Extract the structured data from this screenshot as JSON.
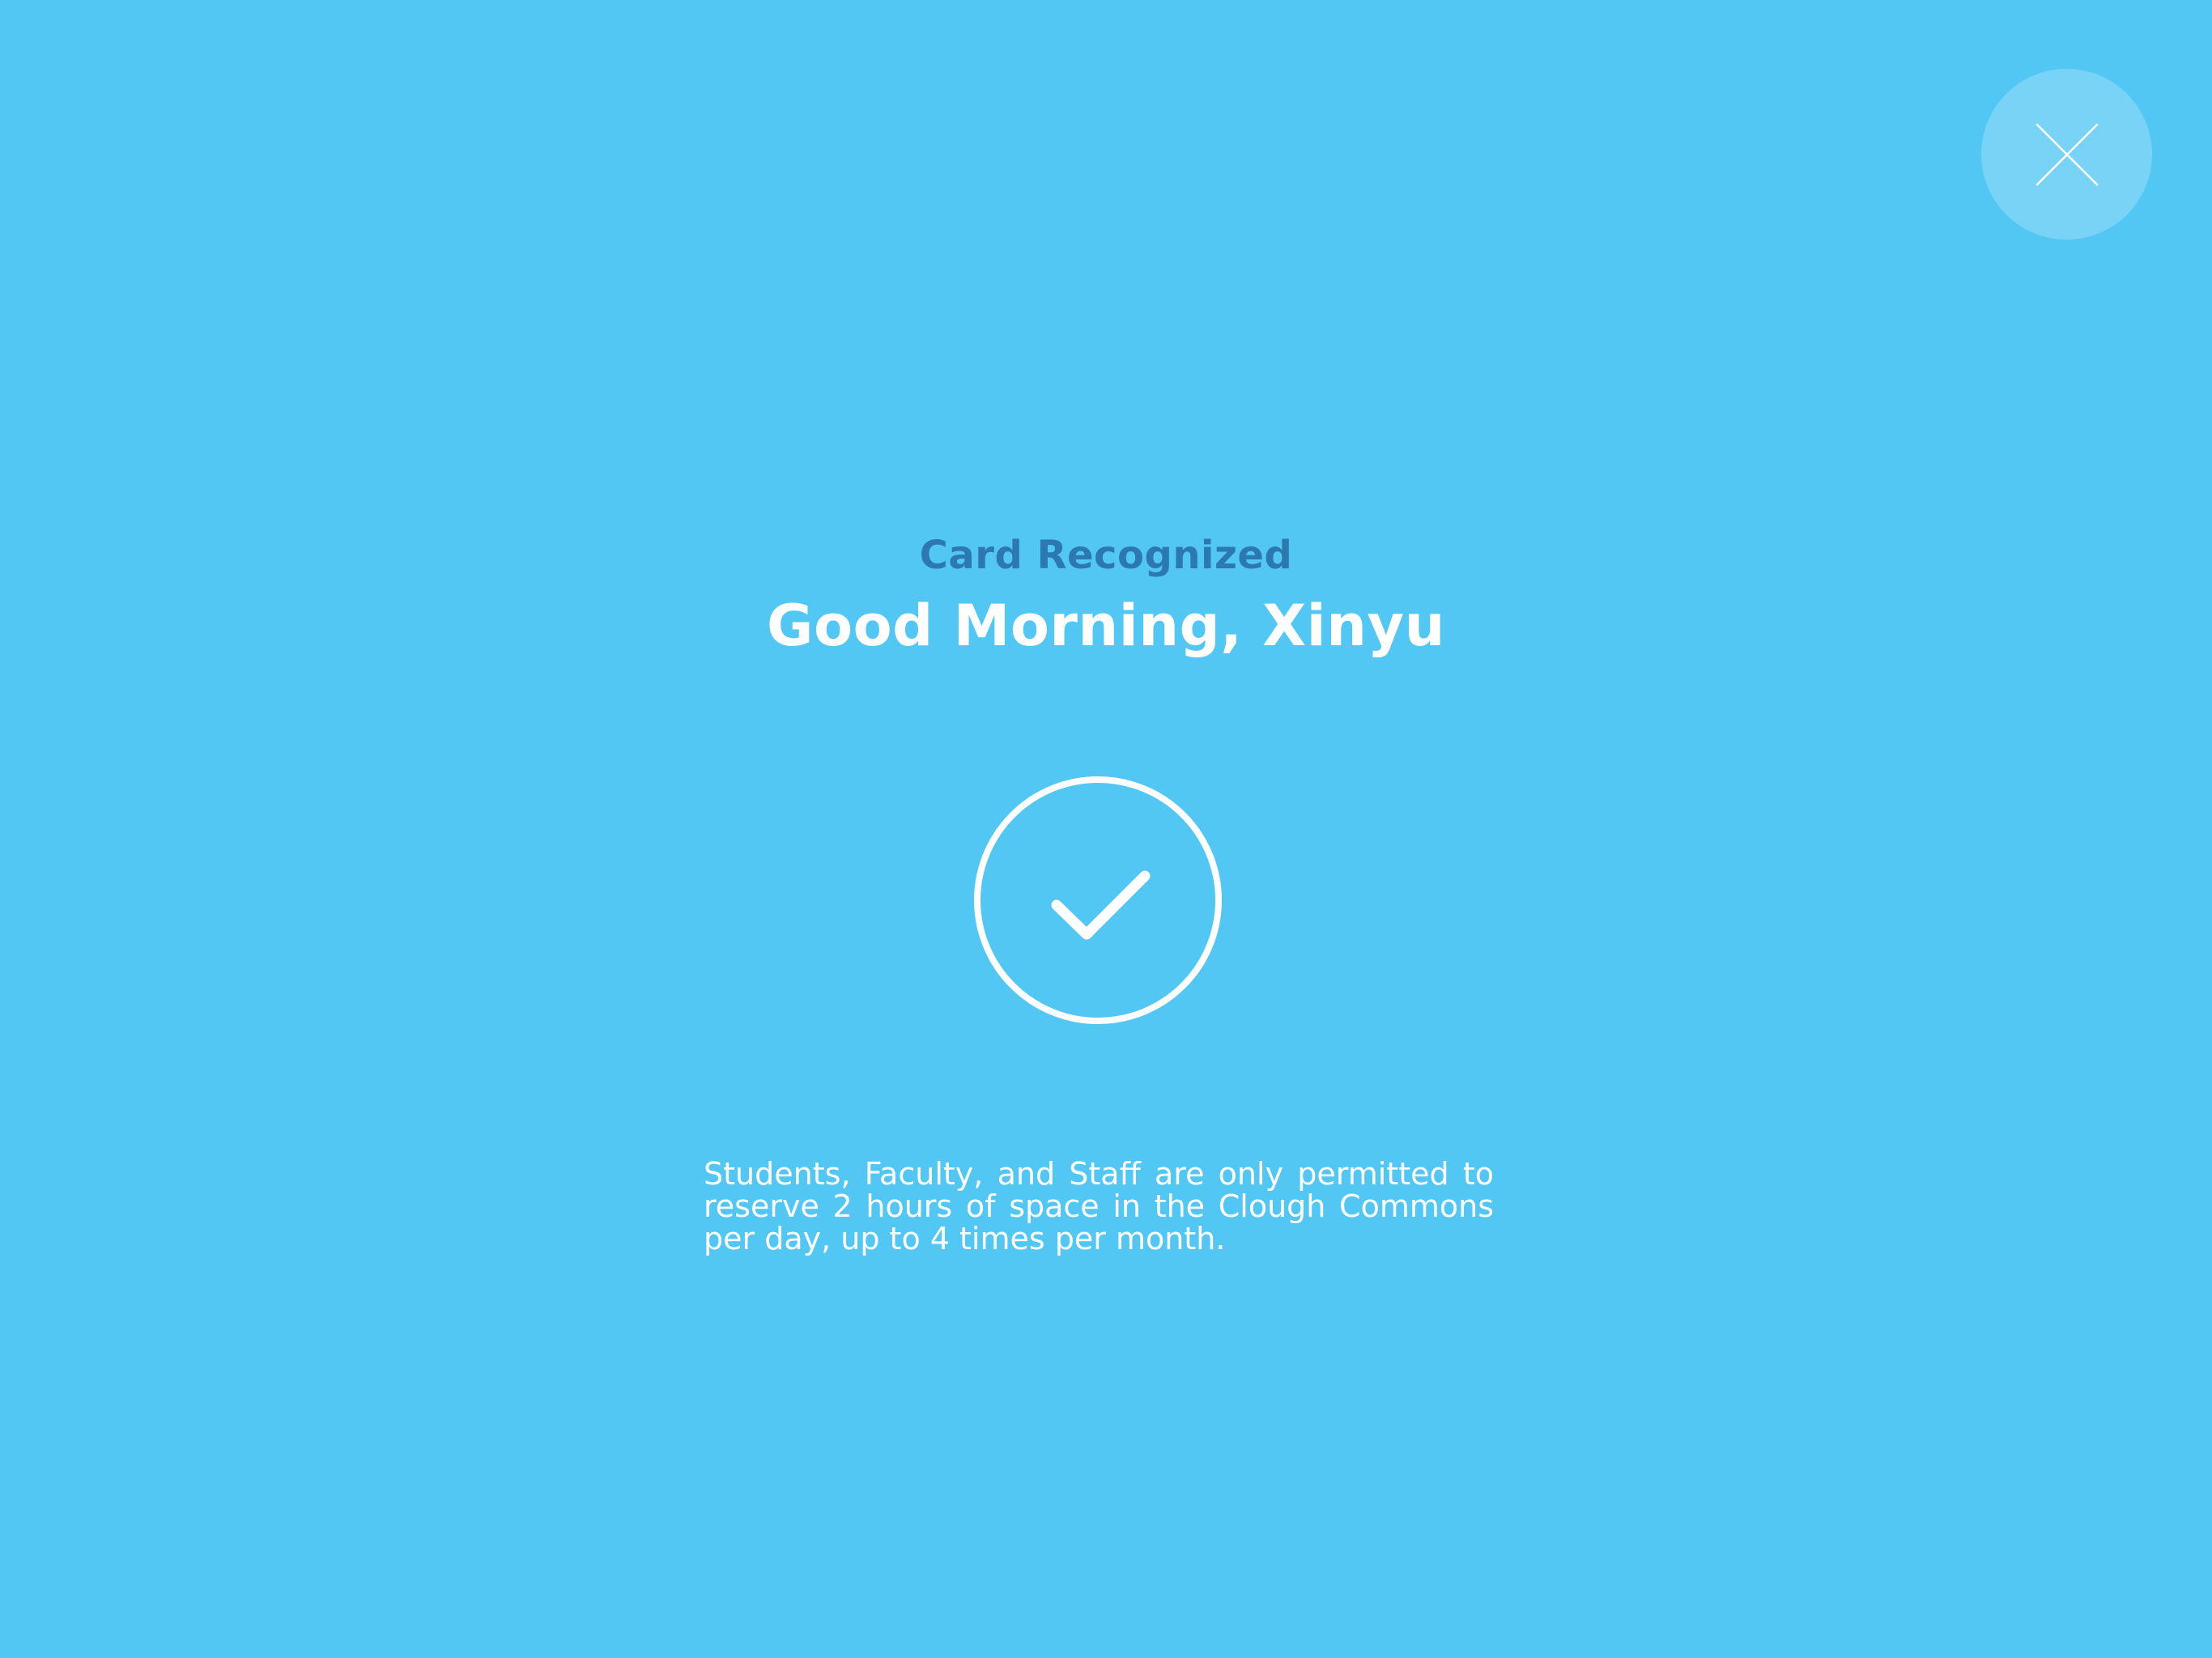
{
  "header": {
    "close_icon": "close-icon"
  },
  "main": {
    "subtitle": "Card Recognized",
    "greeting": "Good Morning, Xinyu",
    "status_icon": "check-circle-icon",
    "policy": "Students, Faculty, and Staff are only permitted to reserve 2 hours of space in the Clough Commons per day, up to 4 times per month."
  },
  "colors": {
    "background": "#52c7f4",
    "subtitle": "#2b79b0",
    "text": "#ffffff"
  }
}
